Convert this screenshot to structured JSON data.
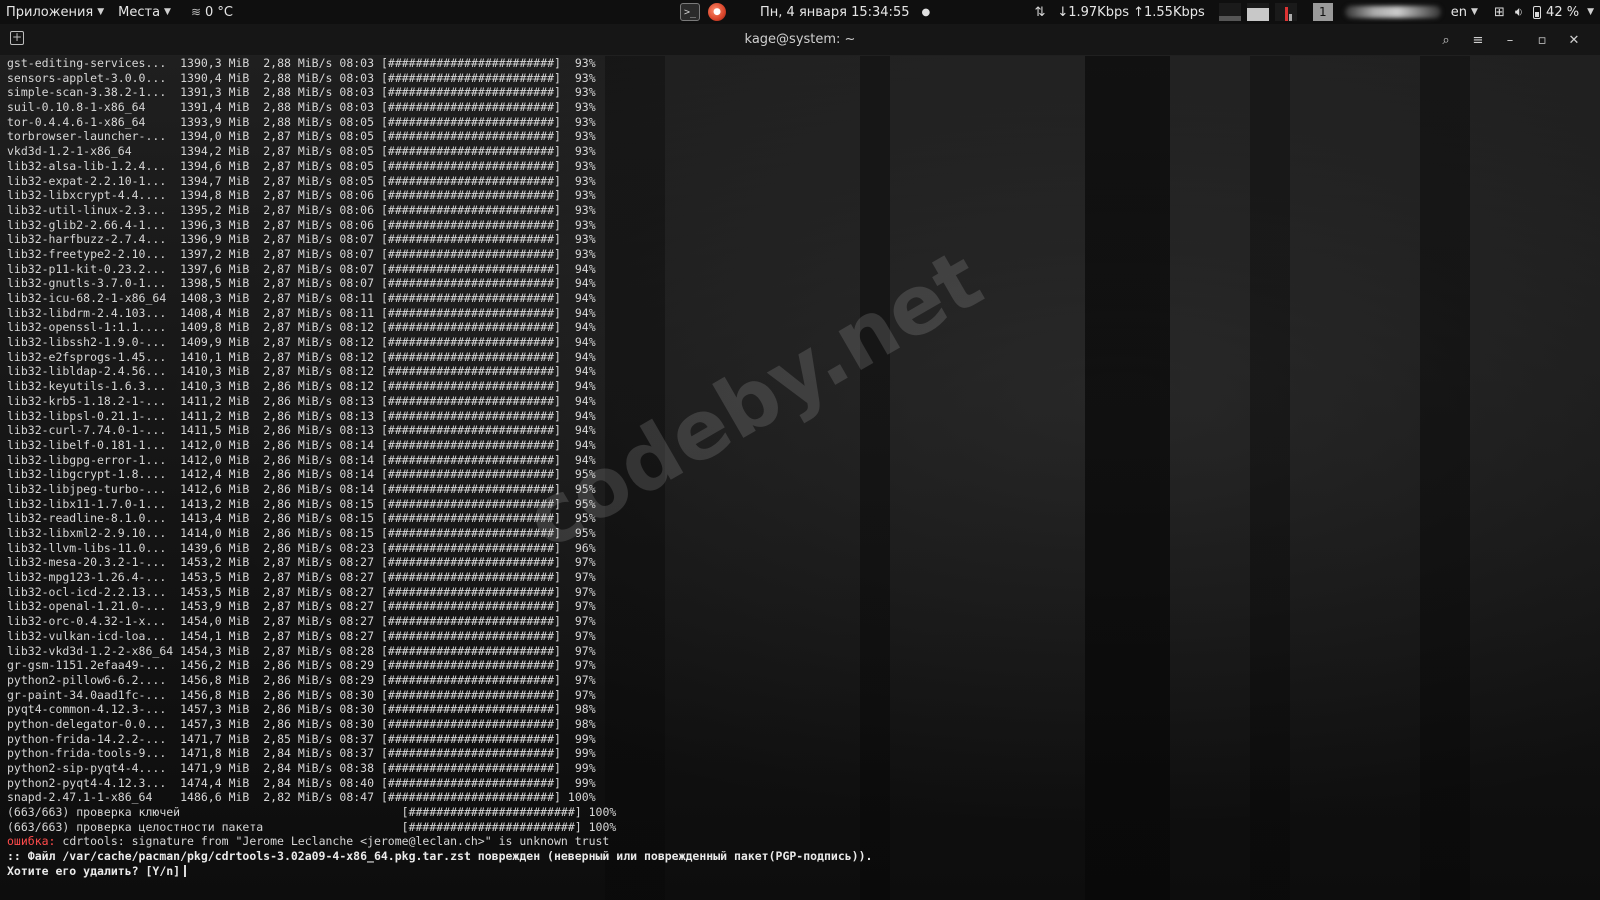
{
  "topbar": {
    "applications": "Приложения",
    "places": "Места",
    "weather_icon": "fog-icon",
    "weather": "0 °C",
    "clock": "Пн, 4 января  15:34:55",
    "net_speed": "↓1.97Kbps ↑1.55Kbps",
    "workspace": "1",
    "language": "en",
    "battery": "42 %"
  },
  "titlebar": {
    "title": "kage@system: ~"
  },
  "terminal": {
    "progress": [
      {
        "name": "gst-editing-services...",
        "size": "1390,3 MiB",
        "rate": "2,88 MiB/s",
        "time": "08:03",
        "bar": "[########################]",
        "pct": "93%"
      },
      {
        "name": "sensors-applet-3.0.0...",
        "size": "1390,4 MiB",
        "rate": "2,88 MiB/s",
        "time": "08:03",
        "bar": "[########################]",
        "pct": "93%"
      },
      {
        "name": "simple-scan-3.38.2-1...",
        "size": "1391,3 MiB",
        "rate": "2,88 MiB/s",
        "time": "08:03",
        "bar": "[########################]",
        "pct": "93%"
      },
      {
        "name": "suil-0.10.8-1-x86_64",
        "size": "1391,4 MiB",
        "rate": "2,88 MiB/s",
        "time": "08:03",
        "bar": "[########################]",
        "pct": "93%"
      },
      {
        "name": "tor-0.4.4.6-1-x86_64",
        "size": "1393,9 MiB",
        "rate": "2,88 MiB/s",
        "time": "08:05",
        "bar": "[########################]",
        "pct": "93%"
      },
      {
        "name": "torbrowser-launcher-...",
        "size": "1394,0 MiB",
        "rate": "2,87 MiB/s",
        "time": "08:05",
        "bar": "[########################]",
        "pct": "93%"
      },
      {
        "name": "vkd3d-1.2-1-x86_64",
        "size": "1394,2 MiB",
        "rate": "2,87 MiB/s",
        "time": "08:05",
        "bar": "[########################]",
        "pct": "93%"
      },
      {
        "name": "lib32-alsa-lib-1.2.4...",
        "size": "1394,6 MiB",
        "rate": "2,87 MiB/s",
        "time": "08:05",
        "bar": "[########################]",
        "pct": "93%"
      },
      {
        "name": "lib32-expat-2.2.10-1...",
        "size": "1394,7 MiB",
        "rate": "2,87 MiB/s",
        "time": "08:05",
        "bar": "[########################]",
        "pct": "93%"
      },
      {
        "name": "lib32-libxcrypt-4.4....",
        "size": "1394,8 MiB",
        "rate": "2,87 MiB/s",
        "time": "08:06",
        "bar": "[########################]",
        "pct": "93%"
      },
      {
        "name": "lib32-util-linux-2.3...",
        "size": "1395,2 MiB",
        "rate": "2,87 MiB/s",
        "time": "08:06",
        "bar": "[########################]",
        "pct": "93%"
      },
      {
        "name": "lib32-glib2-2.66.4-1...",
        "size": "1396,3 MiB",
        "rate": "2,87 MiB/s",
        "time": "08:06",
        "bar": "[########################]",
        "pct": "93%"
      },
      {
        "name": "lib32-harfbuzz-2.7.4...",
        "size": "1396,9 MiB",
        "rate": "2,87 MiB/s",
        "time": "08:07",
        "bar": "[########################]",
        "pct": "93%"
      },
      {
        "name": "lib32-freetype2-2.10...",
        "size": "1397,2 MiB",
        "rate": "2,87 MiB/s",
        "time": "08:07",
        "bar": "[########################]",
        "pct": "93%"
      },
      {
        "name": "lib32-p11-kit-0.23.2...",
        "size": "1397,6 MiB",
        "rate": "2,87 MiB/s",
        "time": "08:07",
        "bar": "[########################]",
        "pct": "94%"
      },
      {
        "name": "lib32-gnutls-3.7.0-1...",
        "size": "1398,5 MiB",
        "rate": "2,87 MiB/s",
        "time": "08:07",
        "bar": "[########################]",
        "pct": "94%"
      },
      {
        "name": "lib32-icu-68.2-1-x86_64",
        "size": "1408,3 MiB",
        "rate": "2,87 MiB/s",
        "time": "08:11",
        "bar": "[########################]",
        "pct": "94%"
      },
      {
        "name": "lib32-libdrm-2.4.103...",
        "size": "1408,4 MiB",
        "rate": "2,87 MiB/s",
        "time": "08:11",
        "bar": "[########################]",
        "pct": "94%"
      },
      {
        "name": "lib32-openssl-1:1.1....",
        "size": "1409,8 MiB",
        "rate": "2,87 MiB/s",
        "time": "08:12",
        "bar": "[########################]",
        "pct": "94%"
      },
      {
        "name": "lib32-libssh2-1.9.0-...",
        "size": "1409,9 MiB",
        "rate": "2,87 MiB/s",
        "time": "08:12",
        "bar": "[########################]",
        "pct": "94%"
      },
      {
        "name": "lib32-e2fsprogs-1.45...",
        "size": "1410,1 MiB",
        "rate": "2,87 MiB/s",
        "time": "08:12",
        "bar": "[########################]",
        "pct": "94%"
      },
      {
        "name": "lib32-libldap-2.4.56...",
        "size": "1410,3 MiB",
        "rate": "2,87 MiB/s",
        "time": "08:12",
        "bar": "[########################]",
        "pct": "94%"
      },
      {
        "name": "lib32-keyutils-1.6.3...",
        "size": "1410,3 MiB",
        "rate": "2,86 MiB/s",
        "time": "08:12",
        "bar": "[########################]",
        "pct": "94%"
      },
      {
        "name": "lib32-krb5-1.18.2-1-...",
        "size": "1411,2 MiB",
        "rate": "2,86 MiB/s",
        "time": "08:13",
        "bar": "[########################]",
        "pct": "94%"
      },
      {
        "name": "lib32-libpsl-0.21.1-...",
        "size": "1411,2 MiB",
        "rate": "2,86 MiB/s",
        "time": "08:13",
        "bar": "[########################]",
        "pct": "94%"
      },
      {
        "name": "lib32-curl-7.74.0-1-...",
        "size": "1411,5 MiB",
        "rate": "2,86 MiB/s",
        "time": "08:13",
        "bar": "[########################]",
        "pct": "94%"
      },
      {
        "name": "lib32-libelf-0.181-1...",
        "size": "1412,0 MiB",
        "rate": "2,86 MiB/s",
        "time": "08:14",
        "bar": "[########################]",
        "pct": "94%"
      },
      {
        "name": "lib32-libgpg-error-1...",
        "size": "1412,0 MiB",
        "rate": "2,86 MiB/s",
        "time": "08:14",
        "bar": "[########################]",
        "pct": "94%"
      },
      {
        "name": "lib32-libgcrypt-1.8....",
        "size": "1412,4 MiB",
        "rate": "2,86 MiB/s",
        "time": "08:14",
        "bar": "[########################]",
        "pct": "95%"
      },
      {
        "name": "lib32-libjpeg-turbo-...",
        "size": "1412,6 MiB",
        "rate": "2,86 MiB/s",
        "time": "08:14",
        "bar": "[########################]",
        "pct": "95%"
      },
      {
        "name": "lib32-libx11-1.7.0-1...",
        "size": "1413,2 MiB",
        "rate": "2,86 MiB/s",
        "time": "08:15",
        "bar": "[########################]",
        "pct": "95%"
      },
      {
        "name": "lib32-readline-8.1.0...",
        "size": "1413,4 MiB",
        "rate": "2,86 MiB/s",
        "time": "08:15",
        "bar": "[########################]",
        "pct": "95%"
      },
      {
        "name": "lib32-libxml2-2.9.10...",
        "size": "1414,0 MiB",
        "rate": "2,86 MiB/s",
        "time": "08:15",
        "bar": "[########################]",
        "pct": "95%"
      },
      {
        "name": "lib32-llvm-libs-11.0...",
        "size": "1439,6 MiB",
        "rate": "2,86 MiB/s",
        "time": "08:23",
        "bar": "[########################]",
        "pct": "96%"
      },
      {
        "name": "lib32-mesa-20.3.2-1-...",
        "size": "1453,2 MiB",
        "rate": "2,87 MiB/s",
        "time": "08:27",
        "bar": "[########################]",
        "pct": "97%"
      },
      {
        "name": "lib32-mpg123-1.26.4-...",
        "size": "1453,5 MiB",
        "rate": "2,87 MiB/s",
        "time": "08:27",
        "bar": "[########################]",
        "pct": "97%"
      },
      {
        "name": "lib32-ocl-icd-2.2.13...",
        "size": "1453,5 MiB",
        "rate": "2,87 MiB/s",
        "time": "08:27",
        "bar": "[########################]",
        "pct": "97%"
      },
      {
        "name": "lib32-openal-1.21.0-...",
        "size": "1453,9 MiB",
        "rate": "2,87 MiB/s",
        "time": "08:27",
        "bar": "[########################]",
        "pct": "97%"
      },
      {
        "name": "lib32-orc-0.4.32-1-x...",
        "size": "1454,0 MiB",
        "rate": "2,87 MiB/s",
        "time": "08:27",
        "bar": "[########################]",
        "pct": "97%"
      },
      {
        "name": "lib32-vulkan-icd-loa...",
        "size": "1454,1 MiB",
        "rate": "2,87 MiB/s",
        "time": "08:27",
        "bar": "[########################]",
        "pct": "97%"
      },
      {
        "name": "lib32-vkd3d-1.2-2-x86_64",
        "size": "1454,3 MiB",
        "rate": "2,87 MiB/s",
        "time": "08:28",
        "bar": "[########################]",
        "pct": "97%"
      },
      {
        "name": "gr-gsm-1151.2efaa49-...",
        "size": "1456,2 MiB",
        "rate": "2,86 MiB/s",
        "time": "08:29",
        "bar": "[########################]",
        "pct": "97%"
      },
      {
        "name": "python2-pillow6-6.2....",
        "size": "1456,8 MiB",
        "rate": "2,86 MiB/s",
        "time": "08:29",
        "bar": "[########################]",
        "pct": "97%"
      },
      {
        "name": "gr-paint-34.0aad1fc-...",
        "size": "1456,8 MiB",
        "rate": "2,86 MiB/s",
        "time": "08:30",
        "bar": "[########################]",
        "pct": "97%"
      },
      {
        "name": "pyqt4-common-4.12.3-...",
        "size": "1457,3 MiB",
        "rate": "2,86 MiB/s",
        "time": "08:30",
        "bar": "[########################]",
        "pct": "98%"
      },
      {
        "name": "python-delegator-0.0...",
        "size": "1457,3 MiB",
        "rate": "2,86 MiB/s",
        "time": "08:30",
        "bar": "[########################]",
        "pct": "98%"
      },
      {
        "name": "python-frida-14.2.2-...",
        "size": "1471,7 MiB",
        "rate": "2,85 MiB/s",
        "time": "08:37",
        "bar": "[########################]",
        "pct": "99%"
      },
      {
        "name": "python-frida-tools-9...",
        "size": "1471,8 MiB",
        "rate": "2,84 MiB/s",
        "time": "08:37",
        "bar": "[########################]",
        "pct": "99%"
      },
      {
        "name": "python2-sip-pyqt4-4....",
        "size": "1471,9 MiB",
        "rate": "2,84 MiB/s",
        "time": "08:38",
        "bar": "[########################]",
        "pct": "99%"
      },
      {
        "name": "python2-pyqt4-4.12.3...",
        "size": "1474,4 MiB",
        "rate": "2,84 MiB/s",
        "time": "08:40",
        "bar": "[########################]",
        "pct": "99%"
      },
      {
        "name": "snapd-2.47.1-1-x86_64",
        "size": "1486,6 MiB",
        "rate": "2,82 MiB/s",
        "time": "08:47",
        "bar": "[########################]",
        "pct": "100%"
      }
    ],
    "checks": [
      {
        "label": "(663/663) проверка ключей",
        "bar": "[########################]",
        "pct": "100%"
      },
      {
        "label": "(663/663) проверка целостности пакета",
        "bar": "[########################]",
        "pct": "100%"
      }
    ],
    "error_label": "ошибка:",
    "error_text": " cdrtools: signature from \"Jerome Leclanche <jerome@leclan.ch>\" is unknown trust",
    "file_line": ":: Файл /var/cache/pacman/pkg/cdrtools-3.02a09-4-x86_64.pkg.tar.zst поврежден (неверный или поврежденный пакет(PGP-подпись)).",
    "prompt": "Хотите его удалить? [Y/n]"
  },
  "watermark": "codeby.net"
}
